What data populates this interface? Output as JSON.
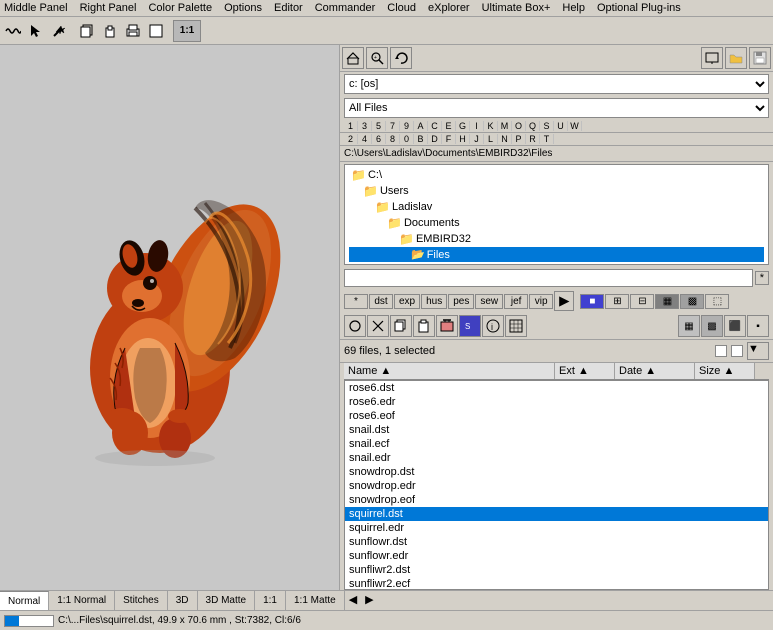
{
  "menubar": {
    "items": [
      "Middle Panel",
      "Right Panel",
      "Color Palette",
      "Options",
      "Editor",
      "Commander",
      "Cloud",
      "eXplorer",
      "Ultimate Box+",
      "Help",
      "Optional Plug-ins"
    ]
  },
  "toolbar": {
    "buttons": [
      {
        "name": "wave-icon",
        "symbol": "〜"
      },
      {
        "name": "scissors-icon",
        "symbol": "✂"
      },
      {
        "name": "magic-icon",
        "symbol": "✦"
      },
      {
        "name": "copy-icon",
        "symbol": "⧉"
      },
      {
        "name": "paste-icon",
        "symbol": "📋"
      },
      {
        "name": "print-icon",
        "symbol": "🖨"
      },
      {
        "name": "new-icon",
        "symbol": "□"
      },
      {
        "name": "ratio-icon",
        "symbol": "1:1",
        "label": "1:1"
      }
    ]
  },
  "right_panel": {
    "drive": "c: [os]",
    "filter": "All Files",
    "path": "C:\\Users\\Ladislav\\Documents\\EMBIRD32\\Files",
    "tree": [
      {
        "label": "C:\\",
        "indent": 0,
        "folder": true
      },
      {
        "label": "Users",
        "indent": 1,
        "folder": true
      },
      {
        "label": "Ladislav",
        "indent": 2,
        "folder": true
      },
      {
        "label": "Documents",
        "indent": 3,
        "folder": true
      },
      {
        "label": "EMBIRD32",
        "indent": 4,
        "folder": true
      },
      {
        "label": "Files",
        "indent": 5,
        "folder": true,
        "selected": true
      }
    ],
    "numbers": [
      "1",
      "3",
      "5",
      "7",
      "9",
      "A",
      "C",
      "E",
      "G",
      "I",
      "K",
      "M",
      "O",
      "Q",
      "S",
      "U",
      "W"
    ],
    "numbers2": [
      "2",
      "4",
      "6",
      "8",
      "0",
      "B",
      "D",
      "F",
      "H",
      "J",
      "L",
      "N",
      "P",
      "R",
      "T"
    ],
    "ext_buttons": [
      "*",
      "dst",
      "exp",
      "hus",
      "pes",
      "sew",
      "jef",
      "vip"
    ],
    "status": "69 files, 1 selected",
    "combo_placeholder": "",
    "star_label": "*",
    "columns": [
      {
        "key": "name",
        "label": "Name ▲"
      },
      {
        "key": "ext",
        "label": "Ext ▲"
      },
      {
        "key": "date",
        "label": "Date ▲"
      },
      {
        "key": "size",
        "label": "Size ▲"
      }
    ],
    "files": [
      {
        "name": "rose6.dst",
        "selected": false
      },
      {
        "name": "rose6.edr",
        "selected": false
      },
      {
        "name": "rose6.eof",
        "selected": false
      },
      {
        "name": "snail.dst",
        "selected": false
      },
      {
        "name": "snail.ecf",
        "selected": false
      },
      {
        "name": "snail.edr",
        "selected": false
      },
      {
        "name": "snowdrop.dst",
        "selected": false
      },
      {
        "name": "snowdrop.edr",
        "selected": false
      },
      {
        "name": "snowdrop.eof",
        "selected": false
      },
      {
        "name": "squirrel.dst",
        "selected": true
      },
      {
        "name": "squirrel.edr",
        "selected": false
      },
      {
        "name": "sunflowr.dst",
        "selected": false
      },
      {
        "name": "sunflowr.edr",
        "selected": false
      },
      {
        "name": "sunfliwr2.dst",
        "selected": false
      },
      {
        "name": "sunfliwr2.ecf",
        "selected": false
      }
    ]
  },
  "tabs": [
    {
      "label": "Normal",
      "active": true
    },
    {
      "label": "1:1 Normal"
    },
    {
      "label": "Stitches"
    },
    {
      "label": "3D"
    },
    {
      "label": "3D Matte"
    },
    {
      "label": "1:1"
    },
    {
      "label": "1:1 Matte"
    }
  ],
  "statusbar": {
    "message": "C:\\...Files\\squirrel.dst, 49.9 x 70.6 mm , St:7382, Cl:6/6"
  }
}
